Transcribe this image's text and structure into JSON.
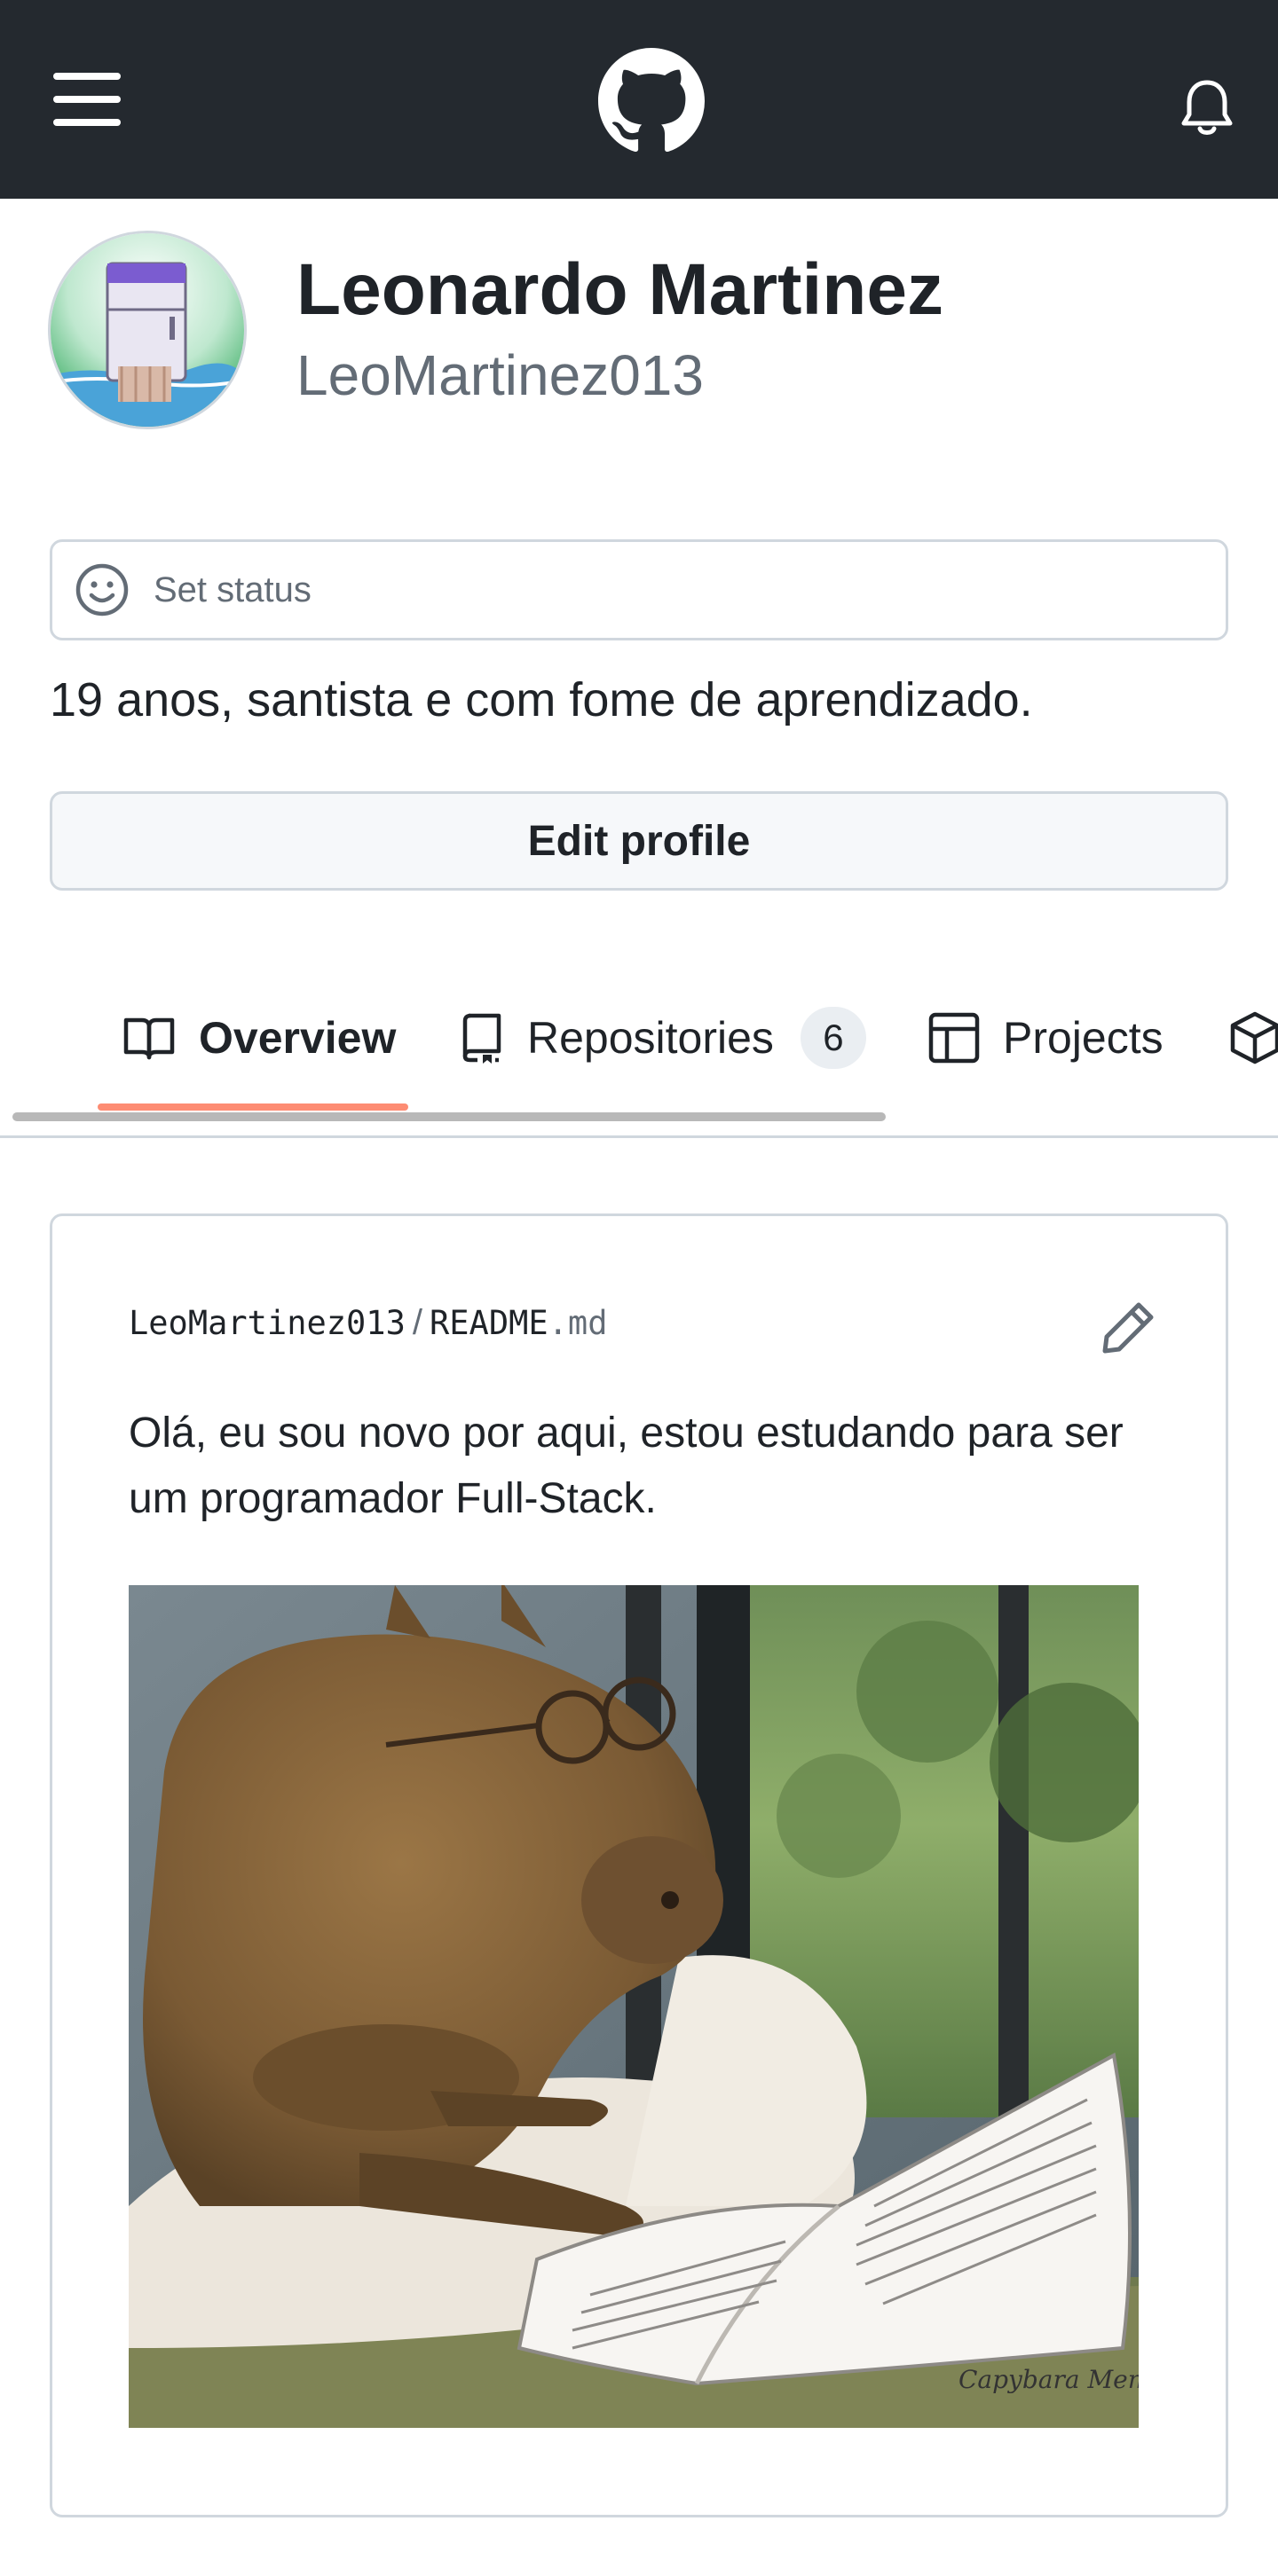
{
  "header": {
    "menu_icon": "hamburger-icon",
    "logo_icon": "github-logo-icon",
    "notifications_icon": "bell-icon"
  },
  "profile": {
    "full_name": "Leonardo Martinez",
    "username": "LeoMartinez013",
    "avatar_icon": "refrigerator-avatar-image",
    "status_placeholder": "Set status",
    "status_icon": "smiley-icon",
    "bio": "19 anos, santista e com fome de aprendizado.",
    "edit_label": "Edit profile"
  },
  "tabs": [
    {
      "label": "Overview",
      "icon": "book-icon",
      "active": true
    },
    {
      "label": "Repositories",
      "icon": "repo-icon",
      "count": "6"
    },
    {
      "label": "Projects",
      "icon": "table-icon"
    },
    {
      "label": "",
      "icon": "package-icon"
    }
  ],
  "readme": {
    "owner": "LeoMartinez013",
    "separator": "/",
    "file_base": "README",
    "file_ext": ".md",
    "edit_icon": "pencil-icon",
    "text": "Olá, eu sou novo por aqui, estou estudando para ser um programador Full-Stack.",
    "image_caption": "Capybara Memes"
  },
  "colors": {
    "header_bg": "#24292f",
    "tab_active_underline": "#fd8c73",
    "border": "#d0d7de",
    "muted_text": "#636c76"
  }
}
